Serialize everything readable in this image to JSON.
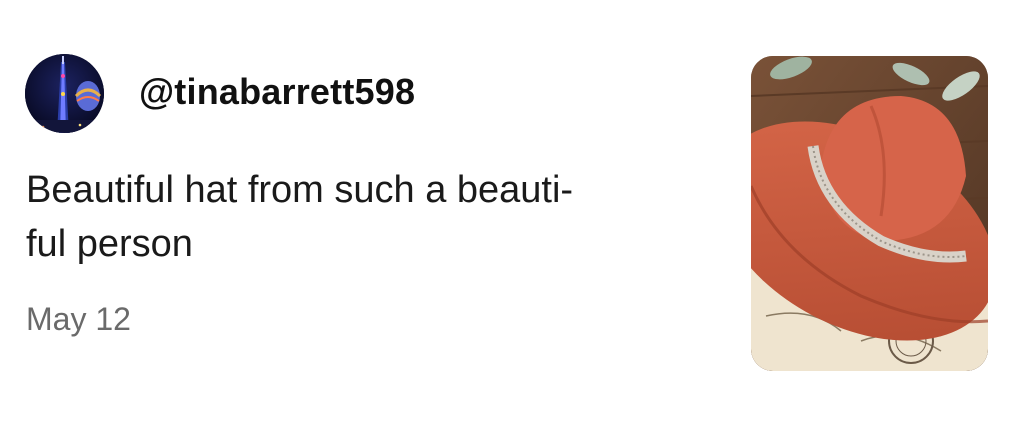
{
  "review": {
    "username": "@tinabarrett598",
    "text_line1": "Beautiful hat from such a beauti-",
    "text_line2": "ful person",
    "date": "May 12"
  },
  "icons": {
    "avatar": "user-avatar-night-tower",
    "photo": "hat-product-photo"
  },
  "colors": {
    "username": "#111111",
    "text": "#1a1a1a",
    "date": "#6a6a6a",
    "hat": "#c85a3c"
  }
}
